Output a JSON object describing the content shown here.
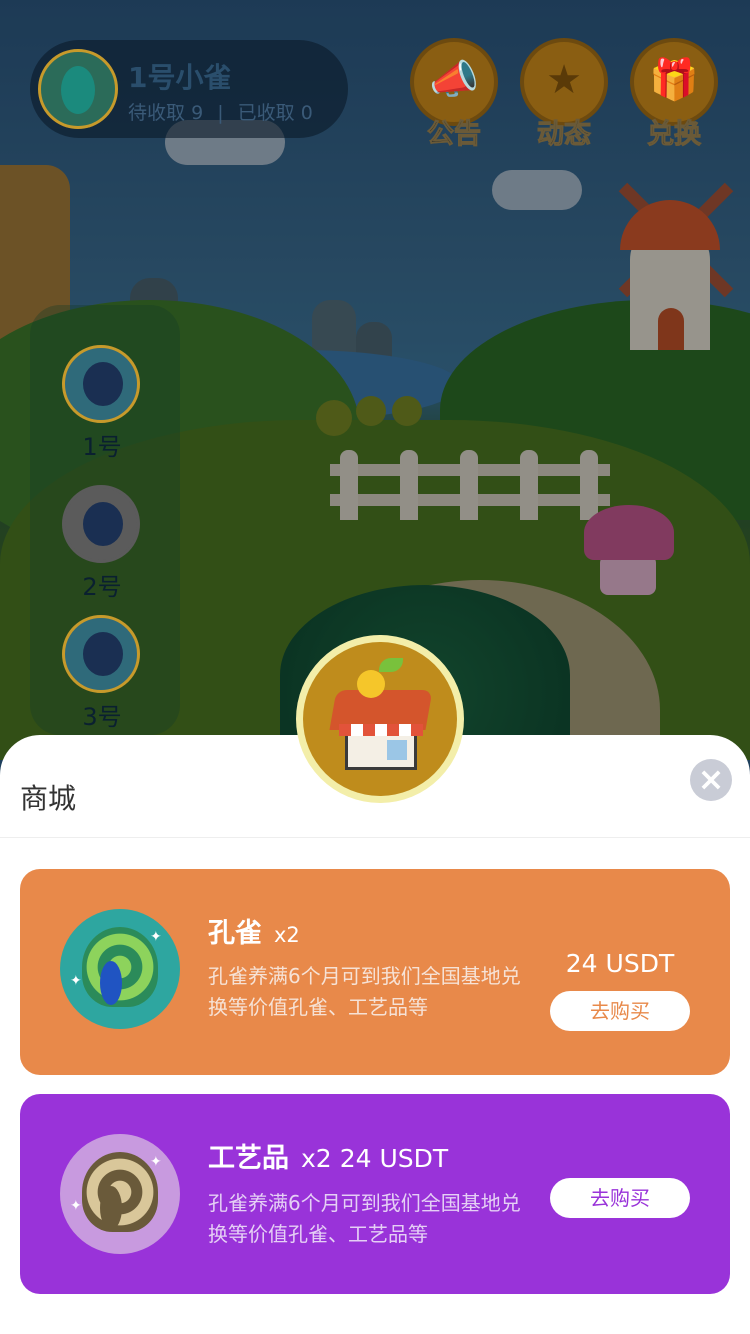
{
  "header": {
    "profile": {
      "name": "1号小雀",
      "pending_label": "待收取",
      "pending_count": "9",
      "separator": "|",
      "collected_label": "已收取",
      "collected_count": "0"
    },
    "buttons": [
      {
        "label": "公告",
        "icon": "megaphone-icon"
      },
      {
        "label": "动态",
        "icon": "news-icon"
      },
      {
        "label": "兑换",
        "icon": "gift-icon"
      }
    ]
  },
  "side_list": [
    {
      "label": "1号"
    },
    {
      "label": "2号"
    },
    {
      "label": "3号"
    }
  ],
  "shop": {
    "title": "商城",
    "badge_icon": "shop-house-icon",
    "close_icon": "close-icon",
    "items": [
      {
        "name": "孔雀",
        "qty": "x2",
        "desc": "孔雀养满6个月可到我们全国基地兑换等价值孔雀、工艺品等",
        "price": "24 USDT",
        "buy_label": "去购买",
        "color": "#e8894a"
      },
      {
        "name": "工艺品",
        "qty": "x2",
        "price": "24 USDT",
        "desc": "孔雀养满6个月可到我们全国基地兑换等价值孔雀、工艺品等",
        "buy_label": "去购买",
        "color": "#9933d9"
      }
    ]
  }
}
